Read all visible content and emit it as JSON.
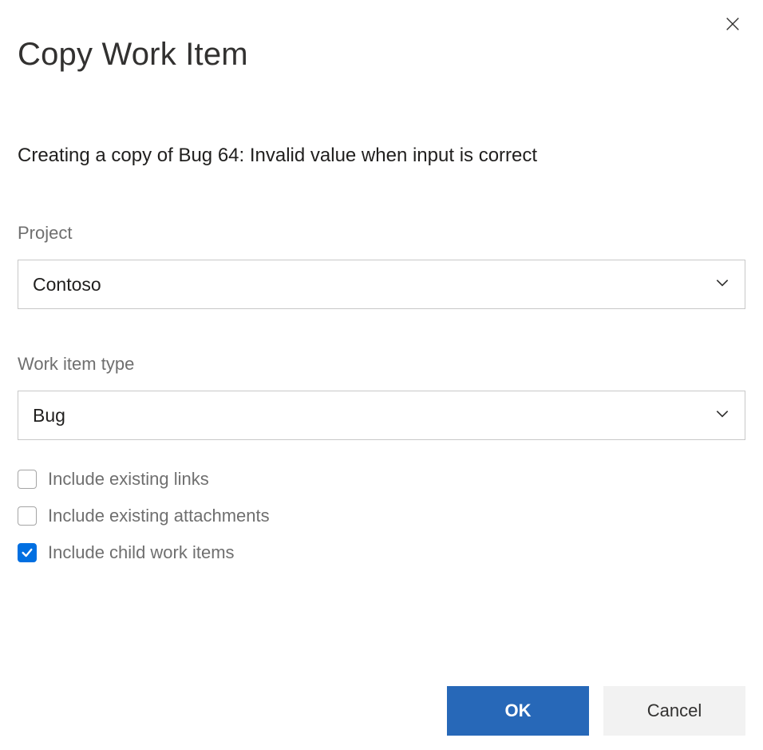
{
  "dialog": {
    "title": "Copy Work Item",
    "subtitle": "Creating a copy of Bug 64: Invalid value when input is correct"
  },
  "fields": {
    "project": {
      "label": "Project",
      "value": "Contoso"
    },
    "workItemType": {
      "label": "Work item type",
      "value": "Bug"
    }
  },
  "checkboxes": {
    "includeLinks": {
      "label": "Include existing links",
      "checked": false
    },
    "includeAttachments": {
      "label": "Include existing attachments",
      "checked": false
    },
    "includeChildren": {
      "label": "Include child work items",
      "checked": true
    }
  },
  "buttons": {
    "ok": "OK",
    "cancel": "Cancel"
  }
}
